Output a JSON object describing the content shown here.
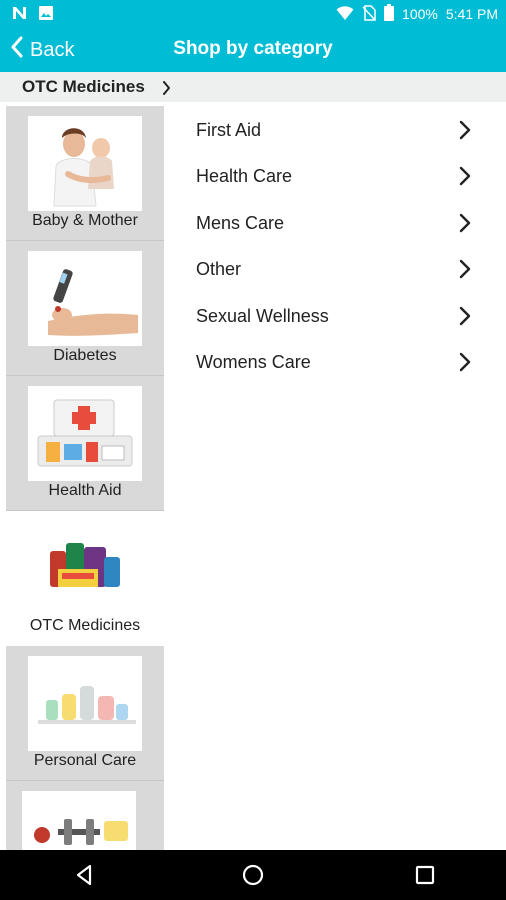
{
  "status_bar": {
    "battery": "100%",
    "time": "5:41 PM"
  },
  "toolbar": {
    "back_label": "Back",
    "title": "Shop by category"
  },
  "breadcrumb": {
    "label": "OTC Medicines"
  },
  "sidebar": {
    "categories": [
      {
        "label": "Baby & Mother",
        "selected": false
      },
      {
        "label": "Diabetes",
        "selected": false
      },
      {
        "label": "Health Aid",
        "selected": false
      },
      {
        "label": "OTC Medicines",
        "selected": true
      },
      {
        "label": "Personal Care",
        "selected": false
      },
      {
        "label": "",
        "selected": false
      }
    ]
  },
  "subcategories": [
    {
      "label": "First Aid"
    },
    {
      "label": "Health Care"
    },
    {
      "label": "Mens Care"
    },
    {
      "label": "Other"
    },
    {
      "label": "Sexual Wellness"
    },
    {
      "label": "Womens Care"
    }
  ],
  "icons": {
    "status_left": [
      "n-notification-icon",
      "image-notification-icon"
    ],
    "status_right": [
      "wifi-icon",
      "no-sim-icon",
      "battery-icon"
    ],
    "nav": [
      "back-triangle-icon",
      "home-circle-icon",
      "recents-square-icon"
    ]
  },
  "colors": {
    "accent": "#00bcd4",
    "sidebar_bg": "#d9d9d9",
    "breadcrumb_bg": "#eef0f0"
  }
}
